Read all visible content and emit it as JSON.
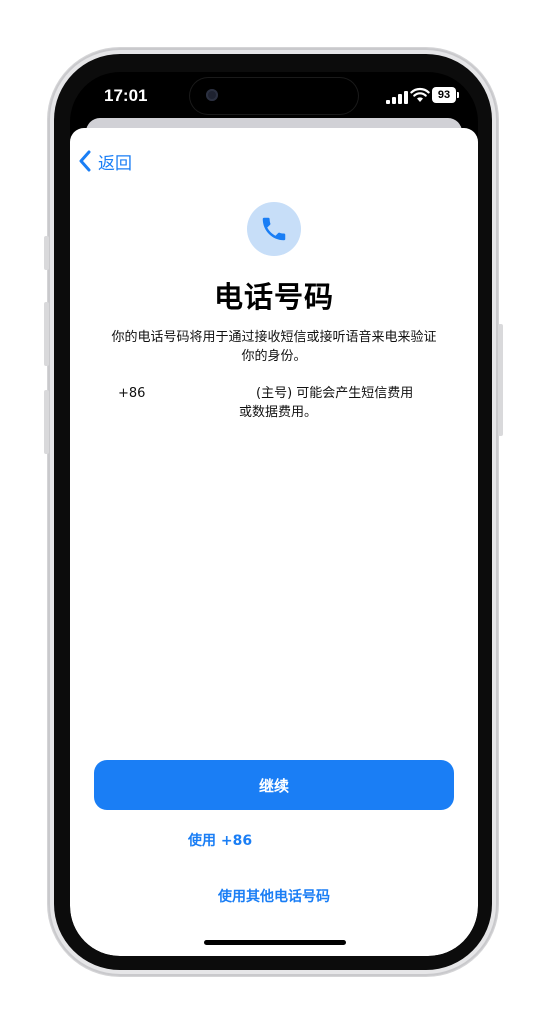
{
  "status_bar": {
    "time": "17:01",
    "battery": "93",
    "icons": [
      "signal-icon",
      "wifi-icon",
      "battery-icon"
    ]
  },
  "nav": {
    "back_label": "返回",
    "back_icon": "chevron-left-icon"
  },
  "header": {
    "icon": "phone-icon",
    "title": "电话号码",
    "description": "你的电话号码将用于通过接收短信或接听语音来电来验证你的身份。"
  },
  "phone_info": {
    "prefix": "+86",
    "note": "(主号) 可能会产生短信费用",
    "note_continued": "或数据费用。"
  },
  "actions": {
    "continue_label": "继续",
    "use_number_label": "使用 +86",
    "other_number_label": "使用其他电话号码"
  },
  "colors": {
    "accent": "#1a7ef5",
    "icon_badge_bg": "#c7def8",
    "sheet_bg": "#ffffff"
  }
}
